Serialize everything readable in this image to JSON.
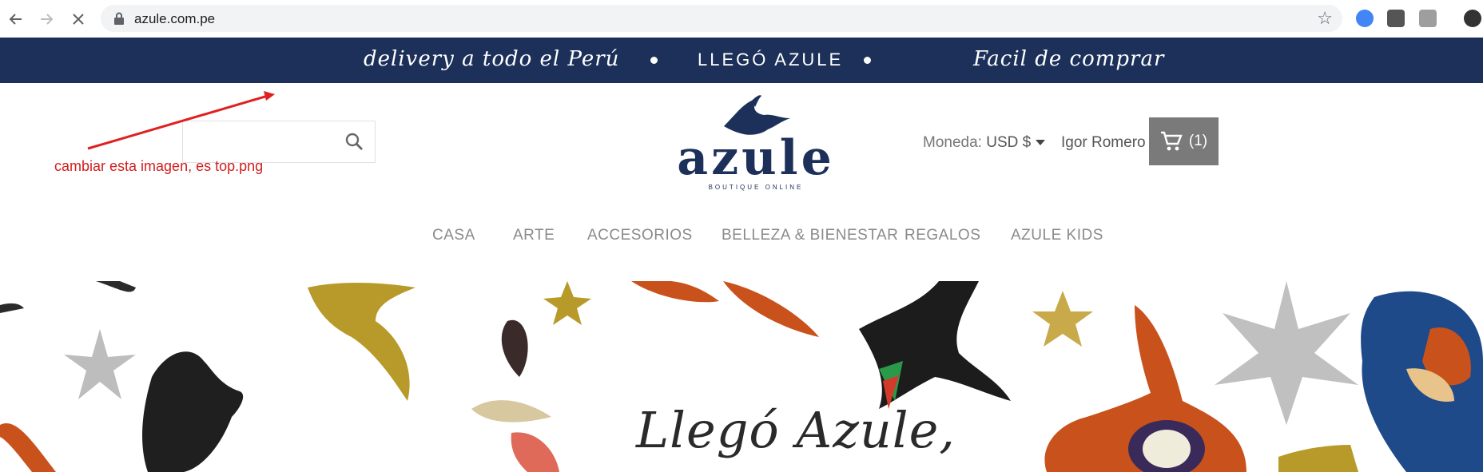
{
  "browser": {
    "url": "azule.com.pe",
    "back_icon": "arrow-left-icon",
    "forward_icon": "arrow-right-icon",
    "stop_icon": "close-icon",
    "lock_icon": "lock-icon",
    "bookmark_icon": "star-icon"
  },
  "promo": {
    "left": "delivery a todo el Perú",
    "center": "LLEGÓ AZULE",
    "right": "Facil  de comprar",
    "bg_color": "#1c3059"
  },
  "header": {
    "search_placeholder": "",
    "annotation": "cambiar esta imagen, es top.png",
    "logo_word": "azule",
    "logo_tagline": "BOUTIQUE ONLINE",
    "currency_label": "Moneda:",
    "currency_value": "USD $",
    "user_name": "Igor Romero",
    "cart_count": "(1)"
  },
  "menu": {
    "items": [
      "CASA",
      "ARTE",
      "ACCESORIOS",
      "BELLEZA & BIENESTAR",
      "REGALOS",
      "AZULE KIDS"
    ]
  },
  "hero": {
    "title": "Llegó Azule,"
  }
}
